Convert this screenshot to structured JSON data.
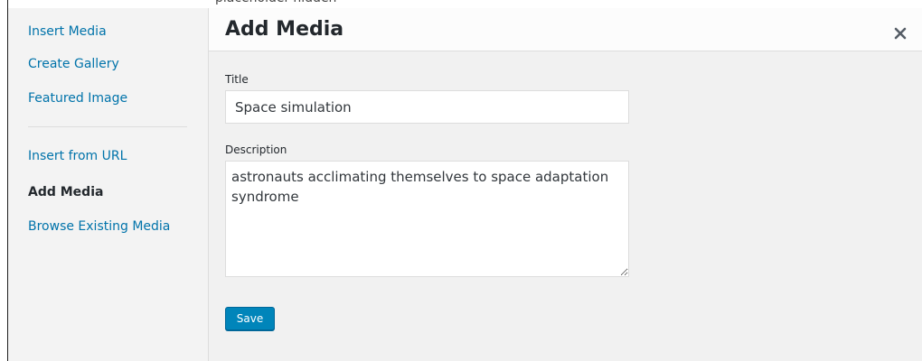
{
  "sidebar": {
    "items": [
      {
        "id": "insert-media",
        "label": "Insert Media",
        "active": false
      },
      {
        "id": "create-gallery",
        "label": "Create Gallery",
        "active": false
      },
      {
        "id": "featured-image",
        "label": "Featured Image",
        "active": false
      },
      {
        "id": "insert-from-url",
        "label": "Insert from URL",
        "active": false
      },
      {
        "id": "add-media",
        "label": "Add Media",
        "active": true
      },
      {
        "id": "browse-existing-media",
        "label": "Browse Existing Media",
        "active": false
      }
    ]
  },
  "header": {
    "title": "Add Media",
    "close_icon": "close-icon"
  },
  "form": {
    "title_label": "Title",
    "title_value": "Space simulation",
    "description_label": "Description",
    "description_value": "astronauts acclimating themselves to space adaptation syndrome",
    "save_label": "Save"
  },
  "colors": {
    "link": "#0073aa",
    "primary_button": "#0085ba",
    "sidebar_bg": "#f3f3f3",
    "content_bg": "#f1f1f1"
  }
}
